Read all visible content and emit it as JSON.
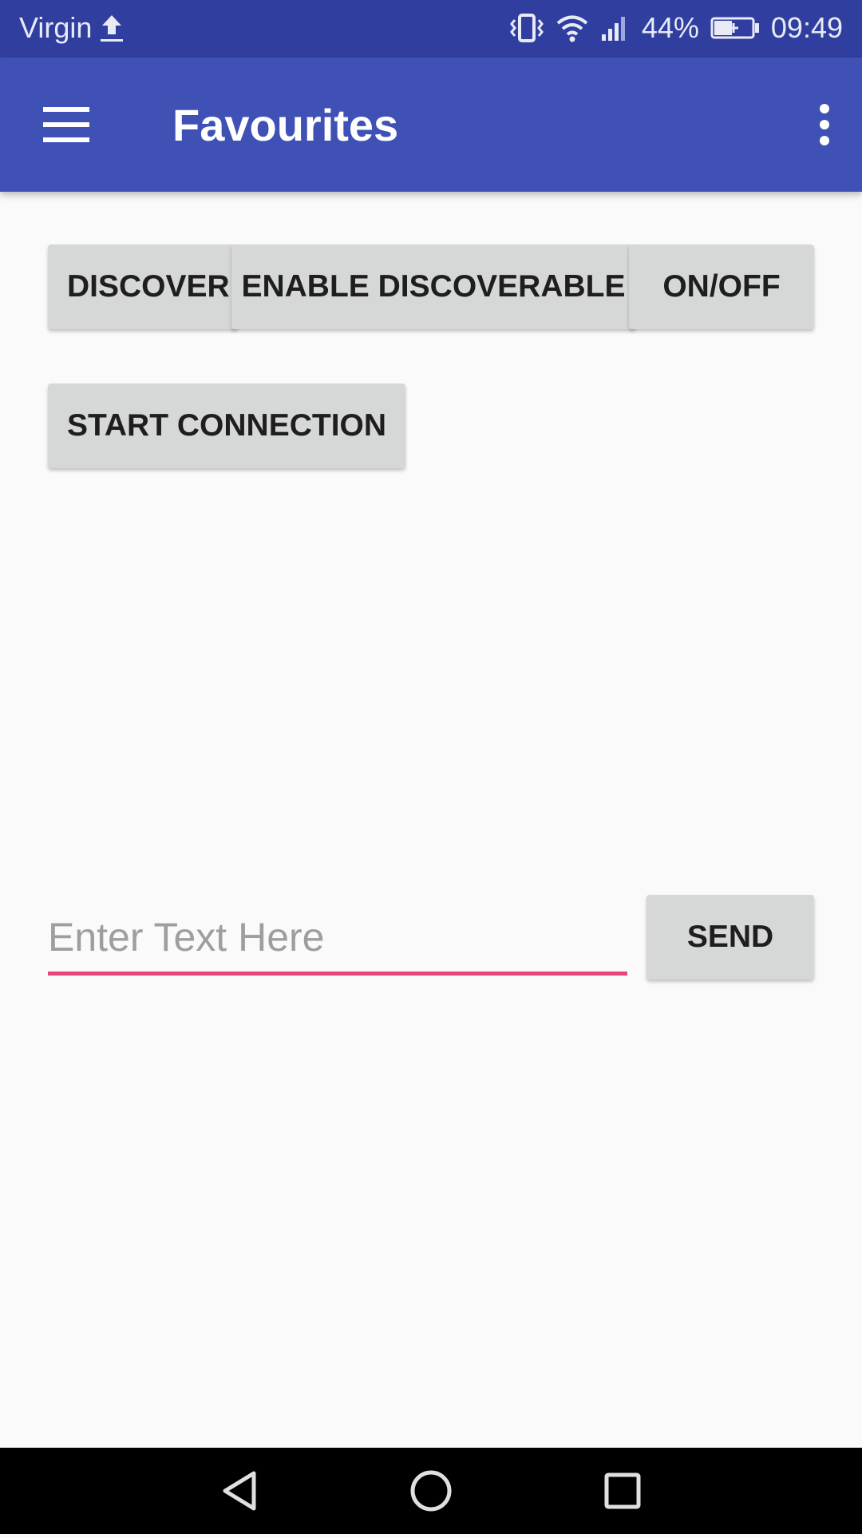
{
  "status_bar": {
    "carrier": "Virgin",
    "battery": "44%",
    "time": "09:49",
    "icons": [
      "upload-icon",
      "vibrate-icon",
      "wifi-icon",
      "signal-icon",
      "battery-charging-icon"
    ]
  },
  "app_bar": {
    "title": "Favourites",
    "icons": [
      "menu-icon",
      "more-vert-icon"
    ]
  },
  "buttons": {
    "discover": "DISCOVER",
    "enable_discoverable": "ENABLE DISCOVERABLE",
    "on_off": "ON/OFF",
    "start_connection": "START CONNECTION",
    "send": "SEND"
  },
  "message_input": {
    "placeholder": "Enter Text Here",
    "value": ""
  },
  "nav_bar": {
    "icons": [
      "back-icon",
      "home-icon",
      "recents-icon"
    ]
  },
  "colors": {
    "status_bar": "#303f9f",
    "app_bar": "#3f51b5",
    "input_underline": "#e8457a",
    "button_bg": "#d6d7d7",
    "page_bg": "#fafafa"
  }
}
